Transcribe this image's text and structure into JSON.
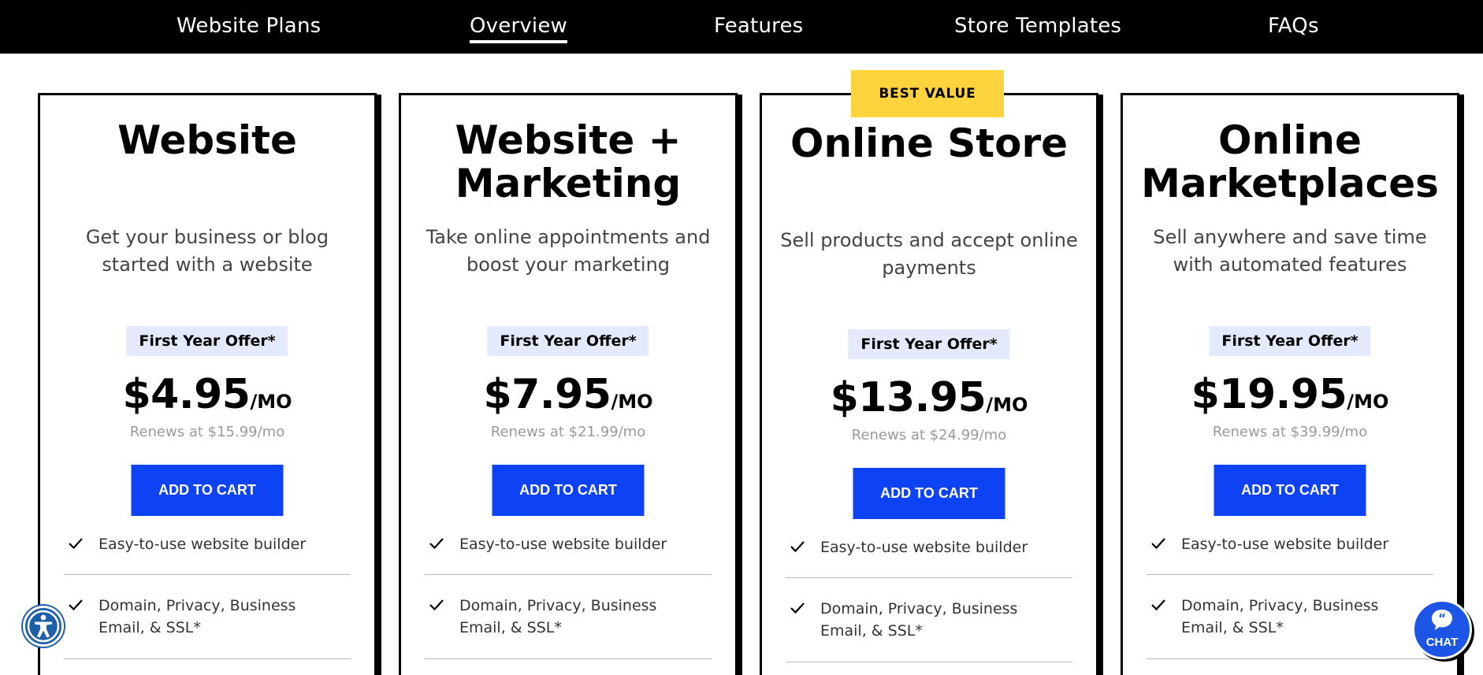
{
  "nav": {
    "items": [
      {
        "label": "Website Plans",
        "active": false
      },
      {
        "label": "Overview",
        "active": true
      },
      {
        "label": "Features",
        "active": false
      },
      {
        "label": "Store Templates",
        "active": false
      },
      {
        "label": "FAQs",
        "active": false
      }
    ]
  },
  "best_value_label": "BEST VALUE",
  "plans": [
    {
      "title_lines": [
        "Website"
      ],
      "description_lines": [
        "Get your business or blog",
        "started with a website"
      ],
      "offer": "First Year Offer*",
      "price": "$4.95",
      "unit": "/MO",
      "renews": "Renews at $15.99/mo",
      "cta": "ADD TO CART",
      "features": [
        {
          "lines": [
            "Easy-to-use website builder"
          ]
        },
        {
          "lines": [
            "Domain, Privacy, Business",
            "Email, & SSL*"
          ]
        }
      ]
    },
    {
      "title_lines": [
        "Website +",
        "Marketing"
      ],
      "description_lines": [
        "Take online appointments and",
        "boost your marketing"
      ],
      "offer": "First Year Offer*",
      "price": "$7.95",
      "unit": "/MO",
      "renews": "Renews at $21.99/mo",
      "cta": "ADD TO CART",
      "features": [
        {
          "lines": [
            "Easy-to-use website builder"
          ]
        },
        {
          "lines": [
            "Domain, Privacy, Business",
            "Email, & SSL*"
          ]
        }
      ]
    },
    {
      "title_lines": [
        "Online Store"
      ],
      "description_lines": [
        "Sell products and accept online",
        "payments"
      ],
      "offer": "First Year Offer*",
      "price": "$13.95",
      "unit": "/MO",
      "renews": "Renews at $24.99/mo",
      "cta": "ADD TO CART",
      "features": [
        {
          "lines": [
            "Easy-to-use website builder"
          ]
        },
        {
          "lines": [
            "Domain, Privacy, Business",
            "Email, & SSL*"
          ]
        }
      ]
    },
    {
      "title_lines": [
        "Online",
        "Marketplaces"
      ],
      "description_lines": [
        "Sell anywhere and save time",
        "with automated features"
      ],
      "offer": "First Year Offer*",
      "price": "$19.95",
      "unit": "/MO",
      "renews": "Renews at $39.99/mo",
      "cta": "ADD TO CART",
      "features": [
        {
          "lines": [
            "Easy-to-use website builder"
          ]
        },
        {
          "lines": [
            "Domain, Privacy, Business",
            "Email, & SSL*"
          ]
        }
      ]
    }
  ],
  "chat_label": "CHAT",
  "icons": {
    "accessibility": "accessibility-icon",
    "chat": "chat-bubble-icon",
    "check": "check-icon"
  },
  "colors": {
    "nav_bg": "#000000",
    "cta_blue": "#0d43f5",
    "badge_yellow": "#ffd33e",
    "offer_bg": "#e4eafc",
    "chat_blue": "#1d55e6"
  }
}
